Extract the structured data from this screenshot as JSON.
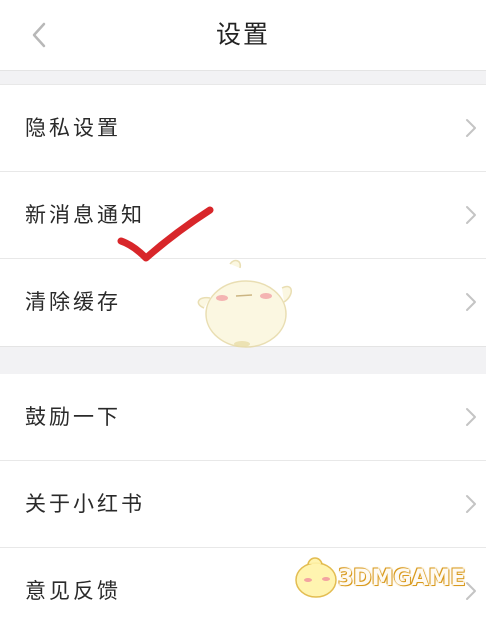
{
  "header": {
    "title": "设置"
  },
  "groups": [
    {
      "items": [
        {
          "label": "隐私设置"
        },
        {
          "label": "新消息通知"
        },
        {
          "label": "清除缓存"
        }
      ]
    },
    {
      "items": [
        {
          "label": "鼓励一下"
        },
        {
          "label": "关于小红书"
        },
        {
          "label": "意见反馈"
        }
      ]
    }
  ],
  "watermark": {
    "text": "3DMGAME"
  },
  "icons": {
    "back": "chevron-left-icon",
    "row": "chevron-right-icon",
    "mark": "red-checkmark",
    "mascot": "chick-mascot"
  },
  "colors": {
    "check": "#d8262a",
    "chevron": "#c4c4c4",
    "divider": "#e8e8e8",
    "gap": "#f2f2f4"
  }
}
